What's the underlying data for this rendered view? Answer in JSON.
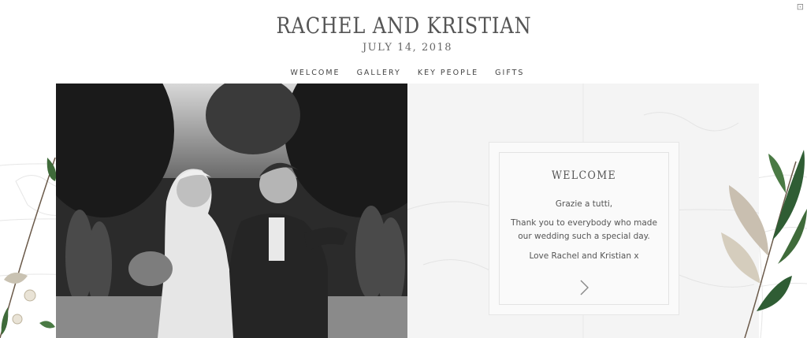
{
  "header": {
    "title": "RACHEL AND KRISTIAN",
    "date": "JULY 14, 2018"
  },
  "nav": {
    "items": [
      "WELCOME",
      "GALLERY",
      "KEY PEOPLE",
      "GIFTS"
    ]
  },
  "corner_icon": "accessibility-icon",
  "welcome_card": {
    "title": "WELCOME",
    "line1": "Grazie a tutti,",
    "line2": "Thank you to everybody who made",
    "line3": "our wedding such a special day.",
    "line4": "Love Rachel and Kristian x"
  },
  "colors": {
    "text": "#555555",
    "panel_bg": "#f4f4f4",
    "leaf_green": "#3f6b3a"
  }
}
